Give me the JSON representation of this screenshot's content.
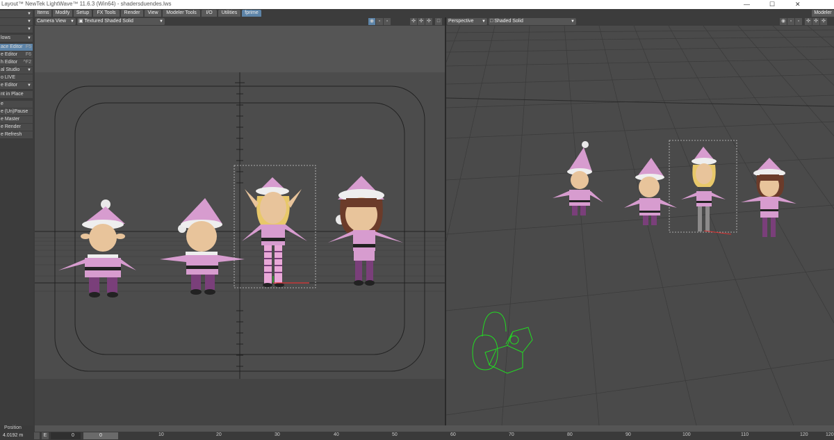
{
  "window": {
    "title": "Layout™ NewTek LightWave™ 11.6.3 (Win64) - shadersduendes.lws",
    "minimize_glyph": "—",
    "maximize_glyph": "☐",
    "close_glyph": "✕"
  },
  "menu_tabs": [
    "Items",
    "Modify",
    "Setup",
    "FX Tools",
    "Render",
    "View",
    "Modeler Tools",
    "I/O",
    "Utilities",
    "fprime"
  ],
  "active_tab": "fprime",
  "modeler_button": "Modeler",
  "sidebar": {
    "items": [
      {
        "label": "lows",
        "key": ""
      },
      {
        "label": "ace Editor",
        "key": "F5"
      },
      {
        "label": "e Editor",
        "key": "F6"
      },
      {
        "label": "h Editor",
        "key": "^F2"
      },
      {
        "label": "al Studio",
        "key": ""
      },
      {
        "label": "o LIVE",
        "key": ""
      },
      {
        "label": "e Editor",
        "key": ""
      },
      {
        "label": "nt in Place",
        "key": ""
      },
      {
        "label": "e",
        "key": ""
      },
      {
        "label": "e (Un)Pause",
        "key": ""
      },
      {
        "label": "e Master",
        "key": ""
      },
      {
        "label": "e Render",
        "key": ""
      },
      {
        "label": "e Refresh",
        "key": ""
      }
    ]
  },
  "left_viewport": {
    "view": "Camera View",
    "shading": "Textured Shaded Solid"
  },
  "right_viewport": {
    "view": "Perspective",
    "shading": "Shaded Solid"
  },
  "timeline": {
    "position_label": "Position",
    "position_value": "4.0192 m",
    "e_button": "E",
    "frame_start": "0",
    "current_frame": "0",
    "ticks": [
      "0",
      "10",
      "20",
      "30",
      "40",
      "50",
      "60",
      "70",
      "80",
      "90",
      "100",
      "110",
      "120",
      "120"
    ]
  },
  "colors": {
    "accent": "#5d84a8",
    "elf_pink": "#d79ccf",
    "elf_purple": "#7a3f7a",
    "camera_green": "#22dd22"
  }
}
